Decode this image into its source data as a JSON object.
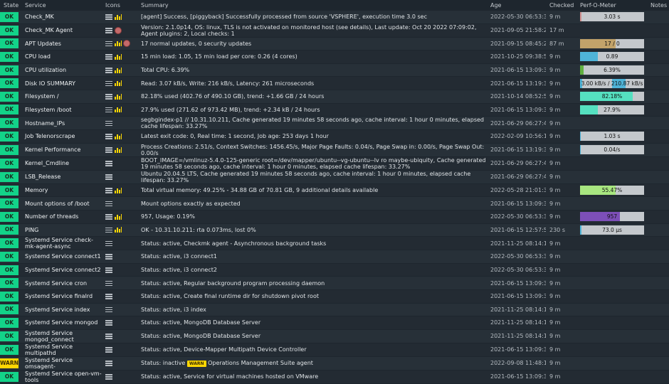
{
  "columns": [
    "State",
    "Service",
    "Icons",
    "Summary",
    "Age",
    "Checked",
    "Perf-O-Meter",
    "Notes"
  ],
  "colors": {
    "ok": "#13d389",
    "warn": "#ffd703",
    "perf_bg": "#c4c8cc"
  },
  "rows": [
    {
      "state": "OK",
      "service": "Check_MK",
      "icons": [
        "menu-icon",
        "graph-icon"
      ],
      "summary": "[agent] Success, [piggyback] Successfully processed from source 'VSPHERE', execution time 3.0 sec",
      "age": "2022-05-30 06:53:37",
      "checked": "9 m",
      "perf": {
        "text": "3.03 s",
        "fill": 0.02,
        "color": "#d09090"
      }
    },
    {
      "state": "OK",
      "service": "Check_MK Agent",
      "icons": [
        "menu-icon",
        "globe-icon"
      ],
      "summary": "Version: 2.1.0p14, OS: linux, TLS is not activated on monitored host (see details), Last update: Oct 20 2022 07:09:02, Agent plugins: 2, Local checks: 1",
      "age": "2021-09-05 21:58:25",
      "checked": "17 m",
      "perf": null
    },
    {
      "state": "OK",
      "service": "APT Updates",
      "icons": [
        "menu-icon",
        "graph-icon",
        "globe-icon"
      ],
      "summary": "17 normal updates, 0 security updates",
      "age": "2021-09-15 08:45:21",
      "checked": "87 m",
      "perf": {
        "text": "17 / 0",
        "fill": 0.55,
        "color": "#c2a36a"
      }
    },
    {
      "state": "OK",
      "service": "CPU load",
      "icons": [
        "menu-icon",
        "graph-icon"
      ],
      "summary": "15 min load: 1.05, 15 min load per core: 0.26 (4 cores)",
      "age": "2021-10-25 09:38:53",
      "checked": "9 m",
      "perf": {
        "text": "0.89",
        "fill": 0.28,
        "color": "#4fb4d8"
      }
    },
    {
      "state": "OK",
      "service": "CPU utilization",
      "icons": [
        "menu-icon",
        "graph-icon"
      ],
      "summary": "Total CPU: 6.39%",
      "age": "2021-06-15 13:09:33",
      "checked": "9 m",
      "perf": {
        "text": "6.39%",
        "fill": 0.06,
        "color": "#60b040"
      }
    },
    {
      "state": "OK",
      "service": "Disk IO SUMMARY",
      "icons": [
        "menu-icon",
        "graph-icon"
      ],
      "summary": "Read: 3.07 kB/s, Write: 216 kB/s, Latency: 261 microseconds",
      "age": "2021-06-15 13:19:34",
      "checked": "9 m",
      "perf": {
        "text": "3.00 kB/s / 210.87 kB/s",
        "fill": 0.03,
        "color": "#4fb4d8",
        "fill2": 0.42,
        "color2": "#4fb4d8"
      }
    },
    {
      "state": "OK",
      "service": "Filesystem /",
      "icons": [
        "menu-icon",
        "graph-icon"
      ],
      "summary": "82.18% used (402.76 of 490.10 GB), trend: +1.66 GB / 24 hours",
      "age": "2021-10-14 08:52:54",
      "checked": "9 m",
      "perf": {
        "text": "82.18%",
        "fill": 0.82,
        "color": "#55e0c0"
      }
    },
    {
      "state": "OK",
      "service": "Filesystem /boot",
      "icons": [
        "menu-icon",
        "graph-icon"
      ],
      "summary": "27.9% used (271.62 of 973.42 MB), trend: +2.34 kB / 24 hours",
      "age": "2021-06-15 13:09:33",
      "checked": "9 m",
      "perf": {
        "text": "27.9%",
        "fill": 0.28,
        "color": "#55e0c0"
      }
    },
    {
      "state": "OK",
      "service": "Hostname_IPs",
      "icons": [
        "menu-icon"
      ],
      "summary": "segbgindex-p1 // 10.31.10.211, Cache generated 19 minutes 58 seconds ago, cache interval: 1 hour 0 minutes, elapsed cache lifespan: 33.27%",
      "age": "2021-06-29 06:27:43",
      "checked": "9 m",
      "perf": null
    },
    {
      "state": "OK",
      "service": "Job Telenorscrape",
      "icons": [
        "menu-icon",
        "graph-icon"
      ],
      "summary": "Latest exit code: 0, Real time: 1 second, Job age: 253 days 1 hour",
      "age": "2022-02-09 10:56:12",
      "checked": "9 m",
      "perf": {
        "text": "1.03 s",
        "fill": 0.01,
        "color": "#4fb4d8"
      }
    },
    {
      "state": "OK",
      "service": "Kernel Performance",
      "icons": [
        "menu-icon",
        "graph-icon"
      ],
      "summary": "Process Creations: 2.51/s, Context Switches: 1456.45/s, Major Page Faults: 0.04/s, Page Swap in: 0.00/s, Page Swap Out: 0.00/s",
      "age": "2021-06-15 13:19:34",
      "checked": "9 m",
      "perf": {
        "text": "0.04/s",
        "fill": 0.01,
        "color": "#4fb4d8"
      }
    },
    {
      "state": "OK",
      "service": "Kernel_Cmdline",
      "icons": [
        "menu-icon"
      ],
      "summary": "BOOT_IMAGE=/vmlinuz-5.4.0-125-generic root=/dev/mapper/ubuntu--vg-ubuntu--lv ro maybe-ubiquity, Cache generated 19 minutes 58 seconds ago, cache interval: 1 hour 0 minutes, elapsed cache lifespan: 33.27%",
      "age": "2021-06-29 06:27:43",
      "checked": "9 m",
      "perf": null
    },
    {
      "state": "OK",
      "service": "LSB_Release",
      "icons": [
        "menu-icon"
      ],
      "summary": "Ubuntu 20.04.5 LTS, Cache generated 19 minutes 58 seconds ago, cache interval: 1 hour 0 minutes, elapsed cache lifespan: 33.27%",
      "age": "2021-06-29 06:27:43",
      "checked": "9 m",
      "perf": null
    },
    {
      "state": "OK",
      "service": "Memory",
      "icons": [
        "menu-icon",
        "graph-icon"
      ],
      "summary": "Total virtual memory: 49.25% - 34.88 GB of 70.81 GB, 9 additional details available",
      "age": "2022-05-28 21:01:34",
      "checked": "9 m",
      "perf": {
        "text": "55.47%",
        "fill": 0.55,
        "color": "#a8e680"
      }
    },
    {
      "state": "OK",
      "service": "Mount options of /boot",
      "icons": [
        "menu-icon"
      ],
      "summary": "Mount options exactly as expected",
      "age": "2021-06-15 13:09:33",
      "checked": "9 m",
      "perf": null
    },
    {
      "state": "OK",
      "service": "Number of threads",
      "icons": [
        "menu-icon",
        "graph-icon"
      ],
      "summary": "957, Usage: 0.19%",
      "age": "2022-05-30 06:53:37",
      "checked": "9 m",
      "perf": {
        "text": "957",
        "fill": 0.62,
        "color": "#7d4fb8"
      }
    },
    {
      "state": "OK",
      "service": "PING",
      "icons": [
        "menu-icon",
        "graph-icon"
      ],
      "summary": "OK - 10.31.10.211: rta 0.073ms, lost 0%",
      "age": "2021-06-15 12:57:57",
      "checked": "230 s",
      "perf": {
        "text": "73.0 µs",
        "fill": 0.02,
        "color": "#4fb4d8"
      }
    },
    {
      "state": "OK",
      "service": "Systemd Service check-mk-agent-async",
      "icons": [
        "menu-icon"
      ],
      "summary": "Status: active, Checkmk agent - Asynchronous background tasks",
      "age": "2021-11-25 08:14:13",
      "checked": "9 m",
      "perf": null
    },
    {
      "state": "OK",
      "service": "Systemd Service connect1",
      "icons": [
        "menu-icon"
      ],
      "summary": "Status: active, i3 connect1",
      "age": "2022-05-30 06:53:37",
      "checked": "9 m",
      "perf": null
    },
    {
      "state": "OK",
      "service": "Systemd Service connect2",
      "icons": [
        "menu-icon"
      ],
      "summary": "Status: active, i3 connect2",
      "age": "2022-05-30 06:53:37",
      "checked": "9 m",
      "perf": null
    },
    {
      "state": "OK",
      "service": "Systemd Service cron",
      "icons": [
        "menu-icon"
      ],
      "summary": "Status: active, Regular background program processing daemon",
      "age": "2021-06-15 13:09:33",
      "checked": "9 m",
      "perf": null
    },
    {
      "state": "OK",
      "service": "Systemd Service finalrd",
      "icons": [
        "menu-icon"
      ],
      "summary": "Status: active, Create final runtime dir for shutdown pivot root",
      "age": "2021-06-15 13:09:33",
      "checked": "9 m",
      "perf": null
    },
    {
      "state": "OK",
      "service": "Systemd Service index",
      "icons": [
        "menu-icon"
      ],
      "summary": "Status: active, i3 index",
      "age": "2021-11-25 08:14:13",
      "checked": "9 m",
      "perf": null
    },
    {
      "state": "OK",
      "service": "Systemd Service mongod",
      "icons": [
        "menu-icon"
      ],
      "summary": "Status: active, MongoDB Database Server",
      "age": "2021-11-25 08:14:13",
      "checked": "9 m",
      "perf": null
    },
    {
      "state": "OK",
      "service": "Systemd Service mongod_connect",
      "icons": [
        "menu-icon"
      ],
      "summary": "Status: active, MongoDB Database Server",
      "age": "2021-11-25 08:14:13",
      "checked": "9 m",
      "perf": null
    },
    {
      "state": "OK",
      "service": "Systemd Service multipathd",
      "icons": [
        "menu-icon"
      ],
      "summary": "Status: active, Device-Mapper Multipath Device Controller",
      "age": "2021-06-15 13:09:33",
      "checked": "9 m",
      "perf": null
    },
    {
      "state": "WARN",
      "service": "Systemd Service omsagent-",
      "icons": [
        "menu-icon"
      ],
      "summary_pre": "Status: inactive",
      "summary_badge": "WARN",
      "summary_post": "Operations Management Suite agent",
      "age": "2022-09-08 11:48:18",
      "checked": "9 m",
      "perf": null
    },
    {
      "state": "OK",
      "service": "Systemd Service open-vm-tools",
      "icons": [
        "menu-icon"
      ],
      "summary": "Status: active, Service for virtual machines hosted on VMware",
      "age": "2021-06-15 13:09:33",
      "checked": "9 m",
      "perf": null
    }
  ]
}
